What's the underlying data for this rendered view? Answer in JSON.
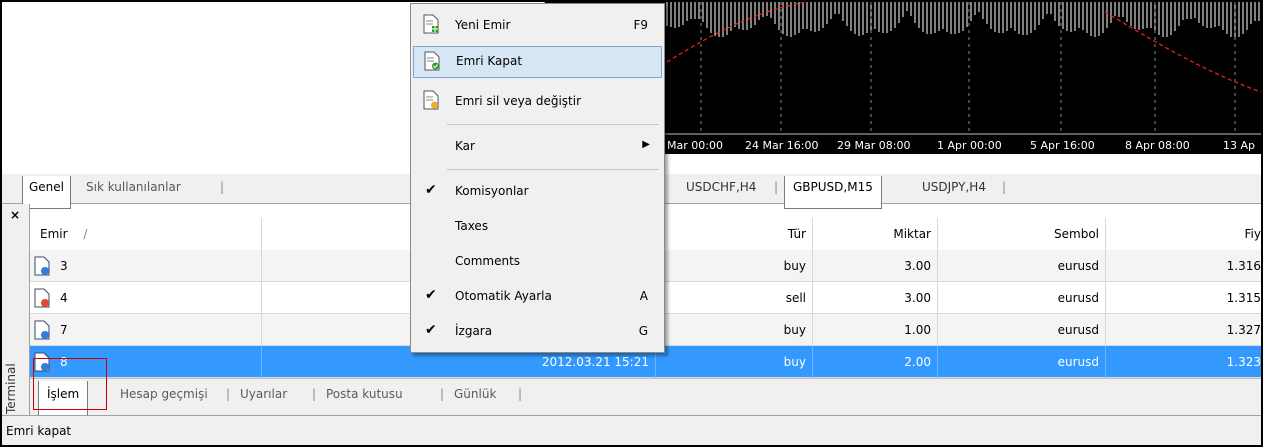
{
  "navigator": {
    "tabs": [
      "Genel",
      "Sık kullanılanlar"
    ]
  },
  "chart": {
    "time_labels": [
      "Mar 00:00",
      "24 Mar 16:00",
      "29 Mar 08:00",
      "1 Apr 00:00",
      "5 Apr 16:00",
      "8 Apr 08:00",
      "13 Ap"
    ]
  },
  "chart_tabs": [
    "USDCHF,H4",
    "GBPUSD,M15",
    "USDJPY,H4"
  ],
  "terminal": {
    "label": "Terminal",
    "close": "×",
    "columns": {
      "emir": "Emir",
      "sort": "/",
      "tur": "Tür",
      "miktar": "Miktar",
      "sembol": "Sembol",
      "fiyat": "Fiy"
    },
    "rows": [
      {
        "emir": "3",
        "time": "",
        "tur": "buy",
        "miktar": "3.00",
        "sembol": "eurusd",
        "fiyat": "1.316"
      },
      {
        "emir": "4",
        "time": "",
        "tur": "sell",
        "miktar": "3.00",
        "sembol": "eurusd",
        "fiyat": "1.315"
      },
      {
        "emir": "7",
        "time": "",
        "tur": "buy",
        "miktar": "1.00",
        "sembol": "eurusd",
        "fiyat": "1.327"
      },
      {
        "emir": "8",
        "time": "2012.03.21 15:21",
        "tur": "buy",
        "miktar": "2.00",
        "sembol": "eurusd",
        "fiyat": "1.323"
      }
    ],
    "bottom_tabs": [
      "İşlem",
      "Hesap geçmişi",
      "Uyarılar",
      "Posta kutusu",
      "Günlük"
    ]
  },
  "status_bar": {
    "text": "Emri kapat"
  },
  "context_menu": {
    "items": [
      {
        "label": "Yeni Emir",
        "shortcut": "F9",
        "icon": "new-order-icon"
      },
      {
        "label": "Emri Kapat",
        "shortcut": "",
        "icon": "close-order-icon"
      },
      {
        "label": "Emri sil veya değiştir",
        "shortcut": "",
        "icon": "modify-order-icon"
      },
      {
        "label": "Kar",
        "shortcut": "",
        "submenu": true
      },
      {
        "label": "Komisyonlar",
        "checked": true
      },
      {
        "label": "Taxes",
        "checked": false
      },
      {
        "label": "Comments",
        "checked": false
      },
      {
        "label": "Otomatik Ayarla",
        "shortcut": "A",
        "checked": true
      },
      {
        "label": "İzgara",
        "shortcut": "G",
        "checked": true
      }
    ],
    "check_glyph": "✔",
    "arrow_glyph": "▶"
  },
  "colors": {
    "selection": "#3399ff",
    "menu_highlight": "#d6e6f5",
    "highlight_box": "#d00000",
    "chart_bg": "#000000"
  }
}
